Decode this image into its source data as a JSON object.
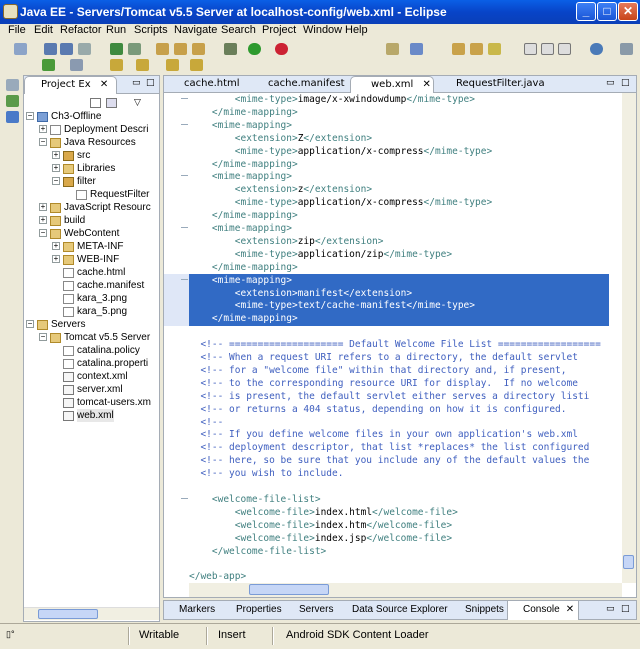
{
  "window": {
    "title": "Java EE - Servers/Tomcat v5.5 Server at localhost-config/web.xml - Eclipse"
  },
  "menu": [
    "File",
    "Edit",
    "Refactor",
    "Run",
    "Scripts",
    "Navigate",
    "Search",
    "Project",
    "Window",
    "Help"
  ],
  "left_panel": {
    "tab_label": "Project Ex",
    "tree": [
      {
        "label": "Ch3-Offline",
        "depth": 0,
        "icon": "project-icon"
      },
      {
        "label": "Deployment Descri",
        "depth": 1,
        "icon": "descriptor-icon"
      },
      {
        "label": "Java Resources",
        "depth": 1,
        "icon": "java-resources-icon"
      },
      {
        "label": "src",
        "depth": 2,
        "icon": "package-folder-icon"
      },
      {
        "label": "Libraries",
        "depth": 2,
        "icon": "libraries-icon"
      },
      {
        "label": "filter",
        "depth": 2,
        "icon": "package-icon"
      },
      {
        "label": "RequestFilter",
        "depth": 3,
        "icon": "java-file-icon"
      },
      {
        "label": "JavaScript Resourc",
        "depth": 1,
        "icon": "javascript-icon"
      },
      {
        "label": "build",
        "depth": 1,
        "icon": "folder-icon"
      },
      {
        "label": "WebContent",
        "depth": 1,
        "icon": "folder-icon"
      },
      {
        "label": "META-INF",
        "depth": 2,
        "icon": "folder-icon"
      },
      {
        "label": "WEB-INF",
        "depth": 2,
        "icon": "folder-icon"
      },
      {
        "label": "cache.html",
        "depth": 2,
        "icon": "html-file-icon"
      },
      {
        "label": "cache.manifest",
        "depth": 2,
        "icon": "file-icon"
      },
      {
        "label": "kara_3.png",
        "depth": 2,
        "icon": "image-file-icon"
      },
      {
        "label": "kara_5.png",
        "depth": 2,
        "icon": "image-file-icon"
      },
      {
        "label": "Servers",
        "depth": 0,
        "icon": "folder-icon"
      },
      {
        "label": "Tomcat v5.5 Server",
        "depth": 1,
        "icon": "folder-icon"
      },
      {
        "label": "catalina.policy",
        "depth": 2,
        "icon": "file-icon"
      },
      {
        "label": "catalina.properti",
        "depth": 2,
        "icon": "file-icon"
      },
      {
        "label": "context.xml",
        "depth": 2,
        "icon": "xml-file-icon"
      },
      {
        "label": "server.xml",
        "depth": 2,
        "icon": "xml-file-icon"
      },
      {
        "label": "tomcat-users.xm",
        "depth": 2,
        "icon": "xml-file-icon"
      },
      {
        "label": "web.xml",
        "depth": 2,
        "icon": "xml-file-icon"
      }
    ]
  },
  "editor": {
    "tabs": [
      "cache.html",
      "cache.manifest",
      "web.xml",
      "RequestFilter.java"
    ],
    "active_tab": "web.xml",
    "lines": [
      "        <mime-type>image/x-xwindowdump</mime-type>",
      "    </mime-mapping>",
      "    <mime-mapping>",
      "        <extension>Z</extension>",
      "        <mime-type>application/x-compress</mime-type>",
      "    </mime-mapping>",
      "    <mime-mapping>",
      "        <extension>z</extension>",
      "        <mime-type>application/x-compress</mime-type>",
      "    </mime-mapping>",
      "    <mime-mapping>",
      "        <extension>zip</extension>",
      "        <mime-type>application/zip</mime-type>",
      "    </mime-mapping>",
      "    <mime-mapping>",
      "        <extension>manifest</extension>",
      "        <mime-type>text/cache-manifest</mime-type>",
      "    </mime-mapping>",
      "",
      "  <!-- ==================== Default Welcome File List ==================",
      "  <!-- When a request URI refers to a directory, the default servlet",
      "  <!-- for a \"welcome file\" within that directory and, if present,",
      "  <!-- to the corresponding resource URI for display.  If no welcome",
      "  <!-- is present, the default servlet either serves a directory listi",
      "  <!-- or returns a 404 status, depending on how it is configured.",
      "  <!--",
      "  <!-- If you define welcome files in your own application's web.xml",
      "  <!-- deployment descriptor, that list *replaces* the list configured",
      "  <!-- here, so be sure that you include any of the default values the",
      "  <!-- you wish to include.",
      "",
      "    <welcome-file-list>",
      "        <welcome-file>index.html</welcome-file>",
      "        <welcome-file>index.htm</welcome-file>",
      "        <welcome-file>index.jsp</welcome-file>",
      "    </welcome-file-list>",
      "",
      "</web-app>"
    ]
  },
  "bottom_tabs": [
    "Markers",
    "Properties",
    "Servers",
    "Data Source Explorer",
    "Snippets",
    "Console"
  ],
  "bottom_active": "Console",
  "status": {
    "writable": "Writable",
    "insert": "Insert",
    "task": "Android SDK Content Loader"
  },
  "colors": {
    "selection": "#316ac5",
    "tag": "#3f7f7f",
    "comment": "#3f5fbf",
    "titlebar": "#0a5fe6"
  }
}
